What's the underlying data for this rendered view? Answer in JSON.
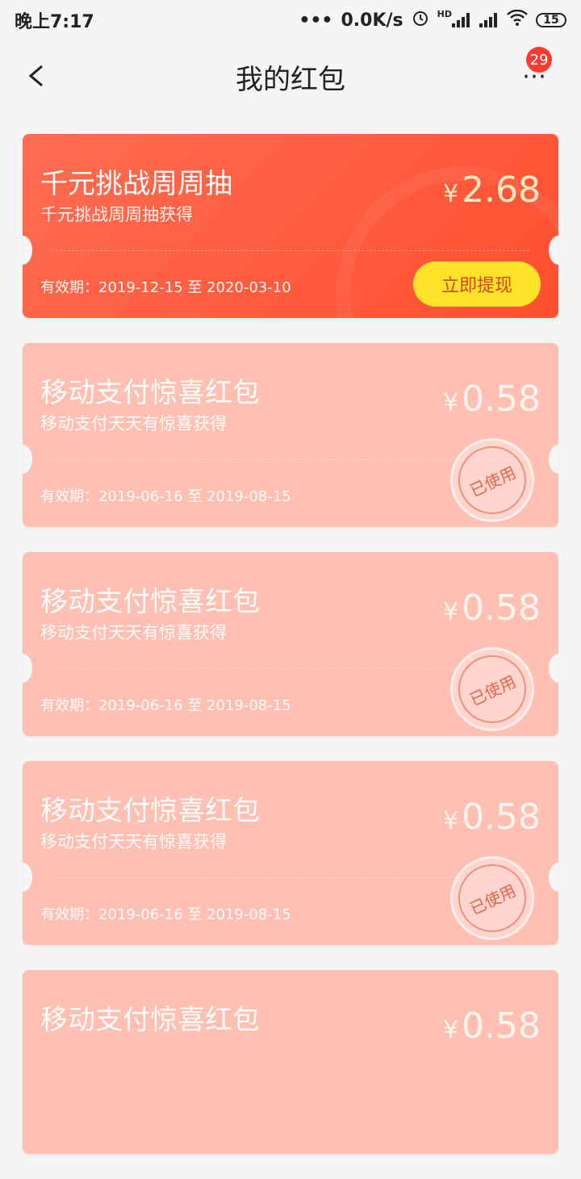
{
  "status_bar": {
    "time": "晚上7:17",
    "dots": "•••",
    "speed": "0.0K/s",
    "hd": "HD",
    "battery": "15"
  },
  "header": {
    "title": "我的红包",
    "badge_count": "29",
    "more_label": "⋯"
  },
  "cards": [
    {
      "title": "千元挑战周周抽",
      "subtitle": "千元挑战周周抽获得",
      "currency": "¥",
      "amount": "2.68",
      "validity": "有效期：2019-12-15 至 2020-03-10",
      "action_label": "立即提现",
      "state": "active"
    },
    {
      "title": "移动支付惊喜红包",
      "subtitle": "移动支付天天有惊喜获得",
      "currency": "¥",
      "amount": "0.58",
      "validity": "有效期：2019-06-16 至 2019-08-15",
      "stamp_label": "已使用",
      "state": "used"
    },
    {
      "title": "移动支付惊喜红包",
      "subtitle": "移动支付天天有惊喜获得",
      "currency": "¥",
      "amount": "0.58",
      "validity": "有效期：2019-06-16 至 2019-08-15",
      "stamp_label": "已使用",
      "state": "used"
    },
    {
      "title": "移动支付惊喜红包",
      "subtitle": "移动支付天天有惊喜获得",
      "currency": "¥",
      "amount": "0.58",
      "validity": "有效期：2019-06-16 至 2019-08-15",
      "stamp_label": "已使用",
      "state": "used"
    },
    {
      "title": "移动支付惊喜红包",
      "subtitle": "",
      "currency": "¥",
      "amount": "0.58",
      "validity": "",
      "stamp_label": "",
      "state": "used"
    }
  ]
}
